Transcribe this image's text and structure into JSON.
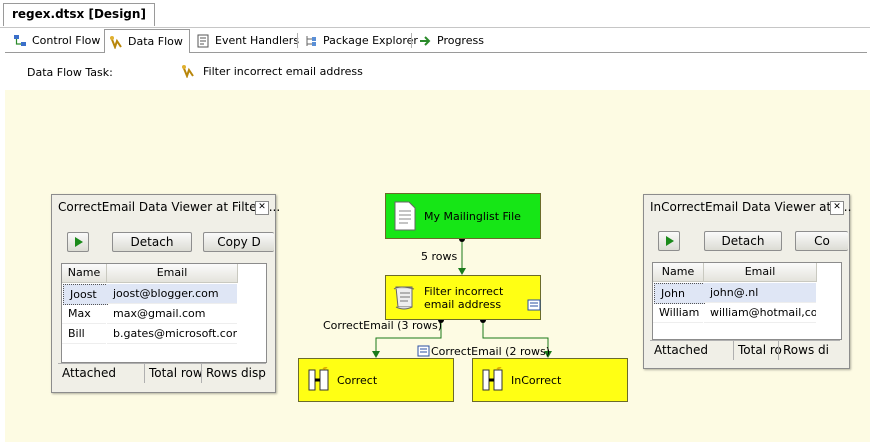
{
  "document_tab": {
    "title": "regex.dtsx [Design]"
  },
  "designer_tabs": [
    {
      "label": "Control Flow",
      "icon": "control-flow-icon",
      "active": false
    },
    {
      "label": "Data Flow",
      "icon": "data-flow-icon",
      "active": true
    },
    {
      "label": "Event Handlers",
      "icon": "event-handlers-icon",
      "active": false
    },
    {
      "label": "Package Explorer",
      "icon": "package-explorer-icon",
      "active": false
    },
    {
      "label": "Progress",
      "icon": "progress-arrow-icon",
      "active": false
    }
  ],
  "task_selector": {
    "label": "Data Flow Task:",
    "value": "Filter incorrect email address"
  },
  "components": {
    "source": {
      "label": "My Mailinglist File",
      "color": "#16e616"
    },
    "filter": {
      "label": "Filter incorrect email address",
      "color": "#ffff14"
    },
    "correct": {
      "label": "Correct",
      "color": "#ffff14"
    },
    "incorrect": {
      "label": "InCorrect",
      "color": "#ffff14"
    }
  },
  "flow_labels": {
    "source_to_filter": "5 rows",
    "filter_to_correct": "CorrectEmail (3 rows)",
    "filter_to_incorrect": "CorrectEmail (2 rows)"
  },
  "viewers": {
    "left": {
      "title": "CorrectEmail Data Viewer at Filter i...",
      "detach_label": "Detach",
      "copy_label": "Copy D",
      "columns": [
        "Name",
        "Email"
      ],
      "rows": [
        [
          "Joost",
          "joost@blogger.com"
        ],
        [
          "Max",
          "max@gmail.com"
        ],
        [
          "Bill",
          "b.gates@microsoft.com"
        ]
      ],
      "status": [
        "Attached",
        "Total row",
        "Rows disp"
      ]
    },
    "right": {
      "title": "InCorrectEmail Data Viewer at F...",
      "detach_label": "Detach",
      "copy_label": "Co",
      "columns": [
        "Name",
        "Email"
      ],
      "rows": [
        [
          "John",
          "john@.nl"
        ],
        [
          "William",
          "william@hotmail,com"
        ]
      ],
      "status": [
        "Attached",
        "Total ro",
        "Rows di"
      ]
    }
  },
  "colors": {
    "canvas": "#fdfbe3",
    "flow_arrow": "#1a7a1a",
    "selected_row": "#dfe6f5"
  }
}
